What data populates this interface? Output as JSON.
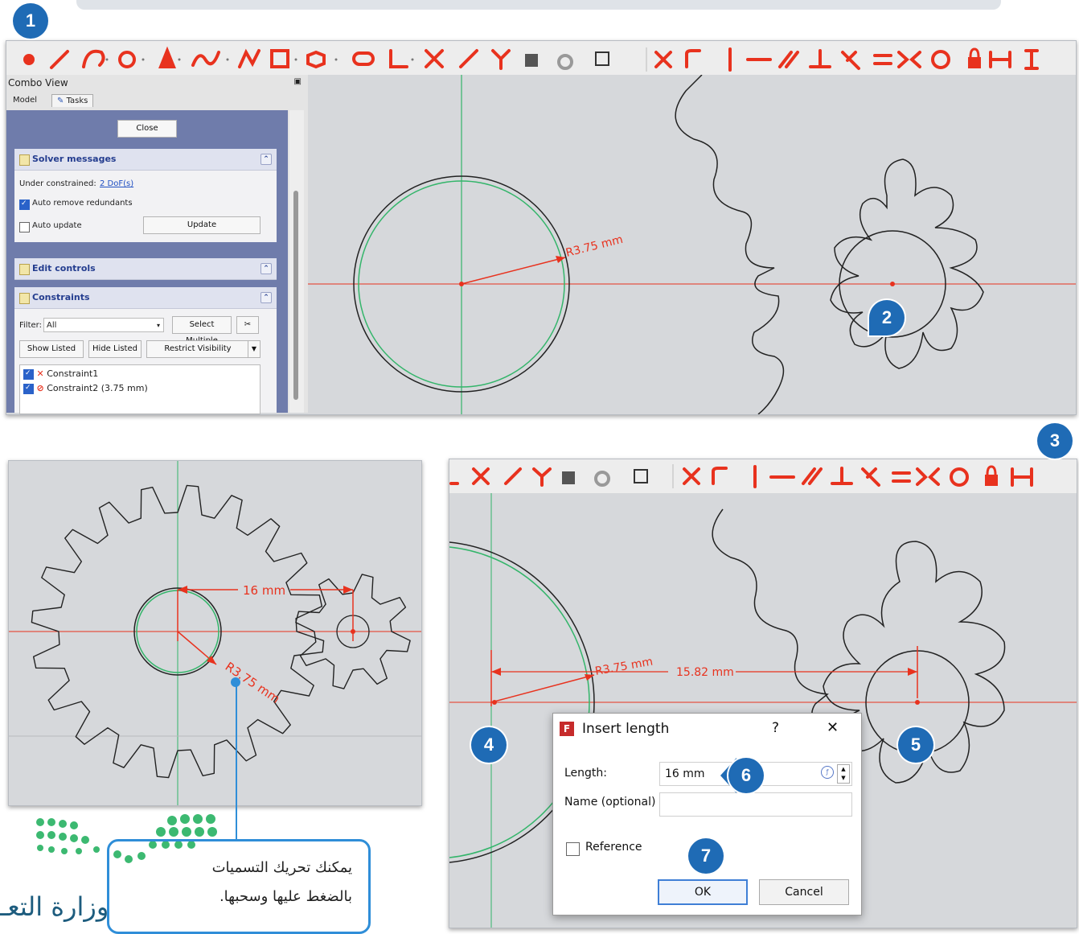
{
  "badges": {
    "b1": "1",
    "b2": "2",
    "b3": "3",
    "b4": "4",
    "b5": "5",
    "b6": "6",
    "b7": "7"
  },
  "combo_view": {
    "title": "Combo View",
    "tabs": {
      "model": "Model",
      "tasks": "Tasks"
    },
    "close_label": "Close",
    "solver": {
      "title": "Solver messages",
      "under_constrained_label": "Under constrained:",
      "dof_link": "2 DoF(s)",
      "auto_remove_label": "Auto remove redundants",
      "auto_remove_checked": true,
      "auto_update_label": "Auto update",
      "auto_update_checked": false,
      "update_label": "Update"
    },
    "edit_controls_title": "Edit controls",
    "constraints": {
      "title": "Constraints",
      "filter_label": "Filter:",
      "filter_value": "All",
      "select_multiple": "Select Multiple",
      "show_listed": "Show Listed",
      "hide_listed": "Hide Listed",
      "restrict_visibility": "Restrict Visibility",
      "items": [
        "Constraint1",
        "Constraint2 (3.75 mm)"
      ]
    }
  },
  "top_view": {
    "radius_label": "R3.75 mm"
  },
  "gear_view": {
    "distance_label": "16 mm",
    "radius_label": "R3.75 mm"
  },
  "bottom_view": {
    "radius_label": "R3.75 mm",
    "distance_label": "15.82 mm"
  },
  "dialog": {
    "title": "Insert length",
    "help": "?",
    "close": "✕",
    "length_label": "Length:",
    "length_value": "16 mm",
    "name_label": "Name (optional)",
    "name_value": "",
    "reference_label": "Reference",
    "reference_checked": false,
    "ok_label": "OK",
    "cancel_label": "Cancel"
  },
  "callout": {
    "line1": "يمكنك تحريك التسميات",
    "line2": "بالضغط عليها وسحبها."
  },
  "ministry_text": "وزارة التعـ",
  "colors": {
    "constraint_red": "#e8321e",
    "badge_blue": "#1f6bb5",
    "construction_green": "#33b56a",
    "panel_blue": "#6f7cab"
  }
}
